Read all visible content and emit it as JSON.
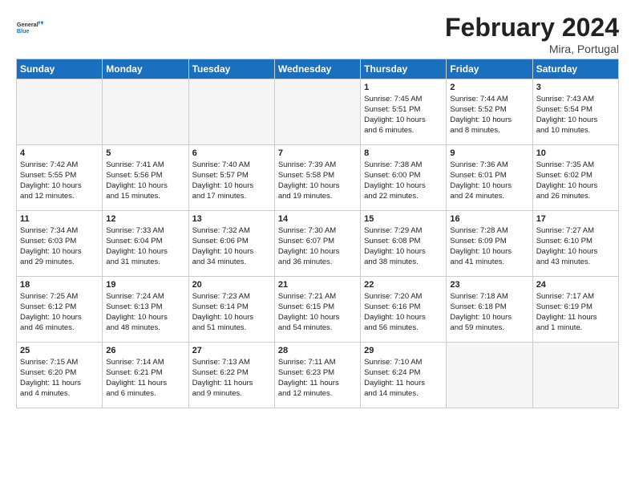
{
  "header": {
    "logo_line1": "General",
    "logo_line2": "Blue",
    "title": "February 2024",
    "subtitle": "Mira, Portugal"
  },
  "weekdays": [
    "Sunday",
    "Monday",
    "Tuesday",
    "Wednesday",
    "Thursday",
    "Friday",
    "Saturday"
  ],
  "weeks": [
    [
      {
        "day": "",
        "info": ""
      },
      {
        "day": "",
        "info": ""
      },
      {
        "day": "",
        "info": ""
      },
      {
        "day": "",
        "info": ""
      },
      {
        "day": "1",
        "info": "Sunrise: 7:45 AM\nSunset: 5:51 PM\nDaylight: 10 hours\nand 6 minutes."
      },
      {
        "day": "2",
        "info": "Sunrise: 7:44 AM\nSunset: 5:52 PM\nDaylight: 10 hours\nand 8 minutes."
      },
      {
        "day": "3",
        "info": "Sunrise: 7:43 AM\nSunset: 5:54 PM\nDaylight: 10 hours\nand 10 minutes."
      }
    ],
    [
      {
        "day": "4",
        "info": "Sunrise: 7:42 AM\nSunset: 5:55 PM\nDaylight: 10 hours\nand 12 minutes."
      },
      {
        "day": "5",
        "info": "Sunrise: 7:41 AM\nSunset: 5:56 PM\nDaylight: 10 hours\nand 15 minutes."
      },
      {
        "day": "6",
        "info": "Sunrise: 7:40 AM\nSunset: 5:57 PM\nDaylight: 10 hours\nand 17 minutes."
      },
      {
        "day": "7",
        "info": "Sunrise: 7:39 AM\nSunset: 5:58 PM\nDaylight: 10 hours\nand 19 minutes."
      },
      {
        "day": "8",
        "info": "Sunrise: 7:38 AM\nSunset: 6:00 PM\nDaylight: 10 hours\nand 22 minutes."
      },
      {
        "day": "9",
        "info": "Sunrise: 7:36 AM\nSunset: 6:01 PM\nDaylight: 10 hours\nand 24 minutes."
      },
      {
        "day": "10",
        "info": "Sunrise: 7:35 AM\nSunset: 6:02 PM\nDaylight: 10 hours\nand 26 minutes."
      }
    ],
    [
      {
        "day": "11",
        "info": "Sunrise: 7:34 AM\nSunset: 6:03 PM\nDaylight: 10 hours\nand 29 minutes."
      },
      {
        "day": "12",
        "info": "Sunrise: 7:33 AM\nSunset: 6:04 PM\nDaylight: 10 hours\nand 31 minutes."
      },
      {
        "day": "13",
        "info": "Sunrise: 7:32 AM\nSunset: 6:06 PM\nDaylight: 10 hours\nand 34 minutes."
      },
      {
        "day": "14",
        "info": "Sunrise: 7:30 AM\nSunset: 6:07 PM\nDaylight: 10 hours\nand 36 minutes."
      },
      {
        "day": "15",
        "info": "Sunrise: 7:29 AM\nSunset: 6:08 PM\nDaylight: 10 hours\nand 38 minutes."
      },
      {
        "day": "16",
        "info": "Sunrise: 7:28 AM\nSunset: 6:09 PM\nDaylight: 10 hours\nand 41 minutes."
      },
      {
        "day": "17",
        "info": "Sunrise: 7:27 AM\nSunset: 6:10 PM\nDaylight: 10 hours\nand 43 minutes."
      }
    ],
    [
      {
        "day": "18",
        "info": "Sunrise: 7:25 AM\nSunset: 6:12 PM\nDaylight: 10 hours\nand 46 minutes."
      },
      {
        "day": "19",
        "info": "Sunrise: 7:24 AM\nSunset: 6:13 PM\nDaylight: 10 hours\nand 48 minutes."
      },
      {
        "day": "20",
        "info": "Sunrise: 7:23 AM\nSunset: 6:14 PM\nDaylight: 10 hours\nand 51 minutes."
      },
      {
        "day": "21",
        "info": "Sunrise: 7:21 AM\nSunset: 6:15 PM\nDaylight: 10 hours\nand 54 minutes."
      },
      {
        "day": "22",
        "info": "Sunrise: 7:20 AM\nSunset: 6:16 PM\nDaylight: 10 hours\nand 56 minutes."
      },
      {
        "day": "23",
        "info": "Sunrise: 7:18 AM\nSunset: 6:18 PM\nDaylight: 10 hours\nand 59 minutes."
      },
      {
        "day": "24",
        "info": "Sunrise: 7:17 AM\nSunset: 6:19 PM\nDaylight: 11 hours\nand 1 minute."
      }
    ],
    [
      {
        "day": "25",
        "info": "Sunrise: 7:15 AM\nSunset: 6:20 PM\nDaylight: 11 hours\nand 4 minutes."
      },
      {
        "day": "26",
        "info": "Sunrise: 7:14 AM\nSunset: 6:21 PM\nDaylight: 11 hours\nand 6 minutes."
      },
      {
        "day": "27",
        "info": "Sunrise: 7:13 AM\nSunset: 6:22 PM\nDaylight: 11 hours\nand 9 minutes."
      },
      {
        "day": "28",
        "info": "Sunrise: 7:11 AM\nSunset: 6:23 PM\nDaylight: 11 hours\nand 12 minutes."
      },
      {
        "day": "29",
        "info": "Sunrise: 7:10 AM\nSunset: 6:24 PM\nDaylight: 11 hours\nand 14 minutes."
      },
      {
        "day": "",
        "info": ""
      },
      {
        "day": "",
        "info": ""
      }
    ]
  ]
}
